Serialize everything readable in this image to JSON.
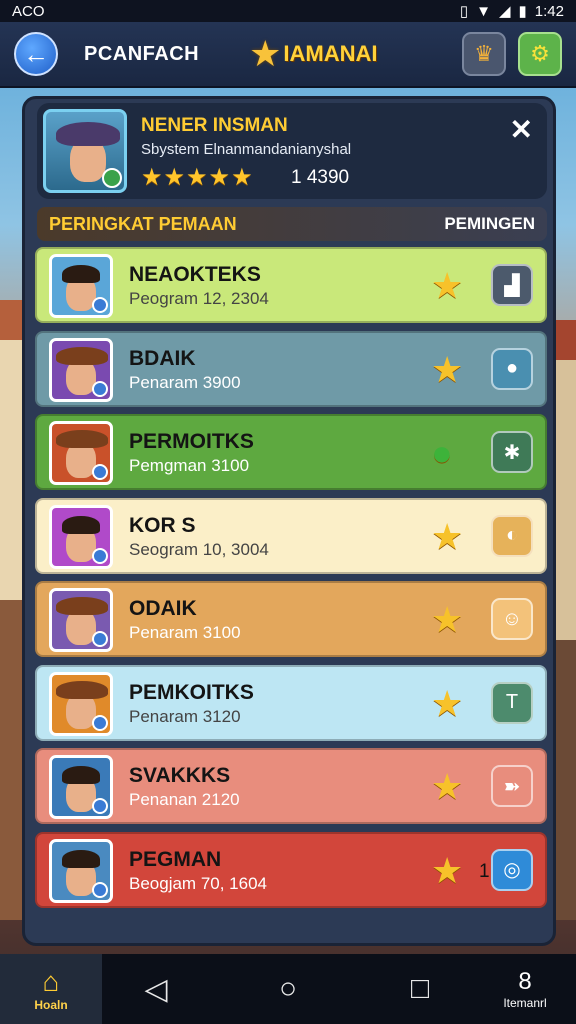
{
  "statusbar": {
    "left": "ACO",
    "time": "1:42",
    "icons": [
      "vibrate-icon",
      "wifi-icon",
      "signal-icon",
      "battery-icon"
    ]
  },
  "topbar": {
    "back_icon": "back-arrow-icon",
    "title": "PCANFACH",
    "game_name": "IAMANAI",
    "crown_icon": "crown-icon",
    "gear_icon": "gear-icon"
  },
  "profile": {
    "name": "NENER INSMAN",
    "subtitle": "Sbystem Elnanmandanianyshal",
    "stars": "★★★★★",
    "score": "1 4390"
  },
  "section": {
    "title": "PERINGKAT PEMAAN",
    "right": "PEMINGEN"
  },
  "rows": [
    {
      "name": "NEAOKTEKS",
      "score": "Peogram 12, 2304",
      "bg": "#c9e87a",
      "badge_bg": "#4c5a6c",
      "badge_icon": "castle-icon",
      "score_dark": true
    },
    {
      "name": "BDAIK",
      "score": "Penaram 3900",
      "bg": "#6f9aa7",
      "badge_bg": "#4a8fb0",
      "badge_icon": "blob-icon",
      "score_dark": false
    },
    {
      "name": "PERMOITKS",
      "score": "Pemgman 3100",
      "bg": "#5ea940",
      "badge_bg": "#3f7a57",
      "badge_icon": "gear-icon",
      "score_dark": false
    },
    {
      "name": "KOR S",
      "score": "Seogram 10, 3004",
      "bg": "#fbefc8",
      "badge_bg": "#e6b25a",
      "badge_icon": "swirl-icon",
      "score_dark": true
    },
    {
      "name": "ODAIK",
      "score": "Penaram 3100",
      "bg": "#e3a75c",
      "badge_bg": "#f3c27a",
      "badge_icon": "ghost-icon",
      "score_dark": false
    },
    {
      "name": "PEMKOITKS",
      "score": "Penaram 3120",
      "bg": "#bde6f3",
      "badge_bg": "#4d8b6d",
      "badge_icon": "pillar-icon",
      "score_dark": true
    },
    {
      "name": "SVAKKKS",
      "score": "Penanan 2120",
      "bg": "#e88d7d",
      "badge_bg": "#e88d7d",
      "badge_icon": "fish-icon",
      "score_dark": false
    },
    {
      "name": "PEGMAN",
      "score": "Beogjam 70, 1604",
      "bg": "#d2463b",
      "badge_bg": "#2f8bd8",
      "badge_icon": "ring-icon",
      "score_dark": false,
      "count": "1"
    }
  ],
  "navbar": {
    "home_label": "Hoaln",
    "profile_label": "Itemanrl"
  }
}
